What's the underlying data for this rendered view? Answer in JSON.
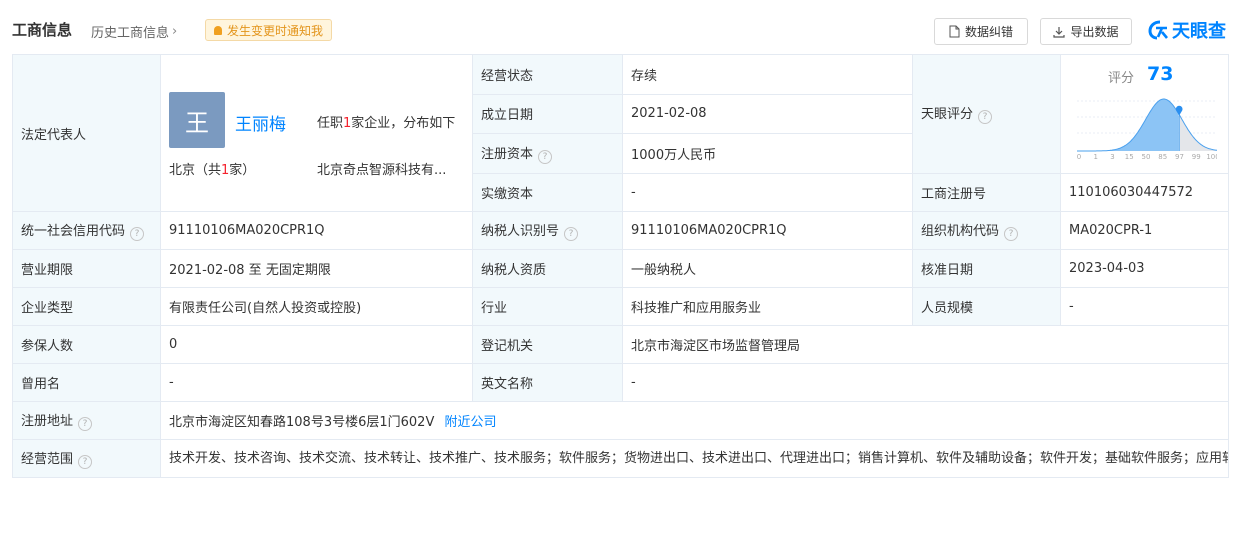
{
  "header": {
    "title": "工商信息",
    "history_label": "历史工商信息",
    "notify_label": "发生变更时通知我",
    "correct_label": "数据纠错",
    "export_label": "导出数据",
    "logo_text": "天眼查"
  },
  "legal_rep": {
    "label": "法定代表人",
    "avatar_char": "王",
    "name": "王丽梅",
    "posts_pre": "任职",
    "posts_count": "1",
    "posts_post": "家企业，分布如下",
    "city_pre": "北京（共",
    "city_count": "1",
    "city_post": "家）",
    "company": "北京奇点智源科技有..."
  },
  "status": {
    "label": "经营状态",
    "value": "存续"
  },
  "founded": {
    "label": "成立日期",
    "value": "2021-02-08"
  },
  "reg_capital": {
    "label": "注册资本",
    "value": "1000万人民币"
  },
  "paid_capital": {
    "label": "实缴资本",
    "value": "-"
  },
  "score": {
    "label": "天眼评分",
    "title": "评分",
    "value": 73,
    "axis": [
      "0",
      "1",
      "3",
      "15",
      "50",
      "85",
      "97",
      "99",
      "100"
    ]
  },
  "reg_number": {
    "label": "工商注册号",
    "value": "110106030447572"
  },
  "credit_code": {
    "label": "统一社会信用代码",
    "value": "91110106MA020CPR1Q"
  },
  "taxpayer_id": {
    "label": "纳税人识别号",
    "value": "91110106MA020CPR1Q"
  },
  "org_code": {
    "label": "组织机构代码",
    "value": "MA020CPR-1"
  },
  "term": {
    "label": "营业期限",
    "value": "2021-02-08 至 无固定期限"
  },
  "taxpayer_type": {
    "label": "纳税人资质",
    "value": "一般纳税人"
  },
  "approve_date": {
    "label": "核准日期",
    "value": "2023-04-03"
  },
  "company_type": {
    "label": "企业类型",
    "value": "有限责任公司(自然人投资或控股)"
  },
  "industry": {
    "label": "行业",
    "value": "科技推广和应用服务业"
  },
  "staff": {
    "label": "人员规模",
    "value": "-"
  },
  "insured": {
    "label": "参保人数",
    "value": "0"
  },
  "authority": {
    "label": "登记机关",
    "value": "北京市海淀区市场监督管理局"
  },
  "former_name": {
    "label": "曾用名",
    "value": "-"
  },
  "english_name": {
    "label": "英文名称",
    "value": "-"
  },
  "address": {
    "label": "注册地址",
    "value": "北京市海淀区知春路108号3号楼6层1门602V",
    "nearby": "附近公司"
  },
  "scope": {
    "label": "经营范围",
    "value": "技术开发、技术咨询、技术交流、技术转让、技术推广、技术服务；软件服务；货物进出口、技术进出口、代理进出口；销售计算机、软件及辅助设备；软件开发；基础软件服务；应用软件服务；计算机系统服务；设计、制作、代理、发布广告；互联网信息服务；基础电信业务。（市场主体依法自主选择经营项目，开展经营活动；互联网信息服务、基础电信业务以及依法须经批准的项目，经相关部门批准后依批准的内容开展经营活动；不得从事国家和本市产业政策禁止和限制类项目的经营活动。）"
  },
  "colors": {
    "accent": "#0084ff",
    "label_bg": "#f2f9fc",
    "border": "#e4eaf2",
    "notify_bg": "#fff5dd",
    "notify_text": "#e3951d",
    "highlight": "#f5222d"
  }
}
